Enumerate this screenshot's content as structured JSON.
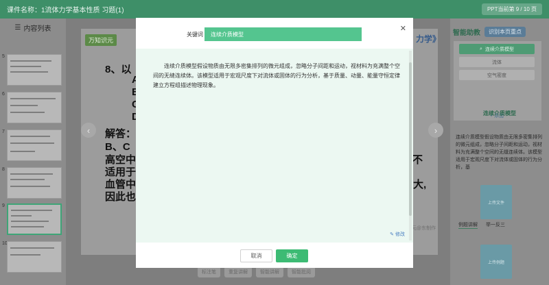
{
  "topbar": {
    "course_title": "课件名称：1流体力学基本性质 习题(1)",
    "page_indicator": "PPT当前第 9 / 10 页"
  },
  "left_panel": {
    "title": "内容列表",
    "thumbnail_numbers": [
      "5",
      "6",
      "7",
      "8",
      "9",
      "10"
    ],
    "active_number": "9"
  },
  "slide": {
    "logo": "万知识元",
    "header_suffix": "力学》",
    "lines": [
      "8、以",
      "A",
      "B",
      "C",
      "D",
      "解答：",
      "B、C",
      "高空中",
      "适用于",
      "血管中",
      "因此也"
    ],
    "right_fragments": [
      "不",
      "大,"
    ],
    "footer_brand": "元@东制作",
    "tools": [
      "标注笔",
      "重复讲解",
      "智能讲解",
      "智能批阅"
    ]
  },
  "right_panel": {
    "title": "智能助教",
    "chip": "识别本页重点",
    "keywords": [
      "连续介质模型",
      "流体",
      "空气密度"
    ],
    "add_label": "+ 添加",
    "section_title": "连续介质模型",
    "description": "连续介质模型假设物质由无限多密集排列的微元组成，忽略分子间距和运动，视材料为充满整个空间的无缝连续体。该模型适用于宏观尺度下对流体或固体的行为分析，基",
    "upload_label": "上传文件",
    "upload_label_2": "上传例题",
    "tabs": [
      "例题讲解",
      "举一反三"
    ]
  },
  "modal": {
    "keyword_label": "关键词",
    "keyword_value": "连续介质模型",
    "content": "连续介质模型假设物质由无限多密集排列的微元组成，忽略分子间距和运动，视材料为充满整个空间的无缝连续体。该模型适用于宏观尺度下对流体或固体的行为分析，基于质量、动量、能量守恒定律建立方程组描述物理现象。",
    "edit_label": "修改",
    "cancel_label": "取消",
    "confirm_label": "确定"
  }
}
